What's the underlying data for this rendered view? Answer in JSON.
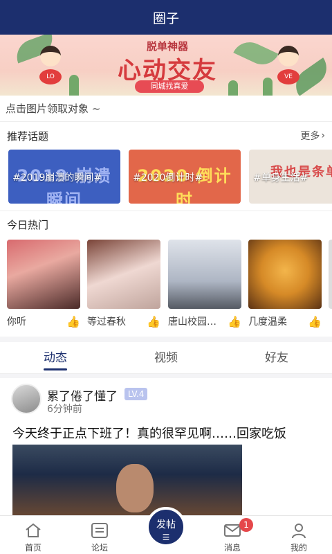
{
  "header": {
    "title": "圈子"
  },
  "banner": {
    "subtitle": "脱单神器",
    "main": "心动交友",
    "pill": "同城找真爱",
    "left_heart": "LO",
    "right_heart": "VE"
  },
  "hint": "点击图片领取对象 ~",
  "topics": {
    "title": "推荐话题",
    "more": "更多",
    "items": [
      {
        "label": "#2019崩溃的瞬间#",
        "art": "2019 崩溃瞬间"
      },
      {
        "label": "#2020倒计时#",
        "art": "2020 倒计时"
      },
      {
        "label": "#单身生活#",
        "art": "我也是条单"
      }
    ]
  },
  "hot": {
    "title": "今日热门",
    "items": [
      {
        "name": "你听"
      },
      {
        "name": "等过春秋"
      },
      {
        "name": "唐山校园…"
      },
      {
        "name": "几度温柔"
      }
    ]
  },
  "tabs": [
    "动态",
    "视频",
    "好友"
  ],
  "post": {
    "username": "累了倦了懂了",
    "level": "LV.4",
    "time": "6分钟前",
    "text": "今天终于正点下班了！真的很罕见啊……回家吃饭"
  },
  "nav": {
    "items": [
      {
        "label": "首页",
        "icon": "home-icon"
      },
      {
        "label": "论坛",
        "icon": "forum-icon"
      },
      {
        "label": "消息",
        "icon": "mail-icon"
      },
      {
        "label": "我的",
        "icon": "user-icon"
      }
    ],
    "fab": "发帖",
    "badge": "1"
  },
  "colors": {
    "primary": "#1c2f6e",
    "badge": "#e5474a"
  }
}
